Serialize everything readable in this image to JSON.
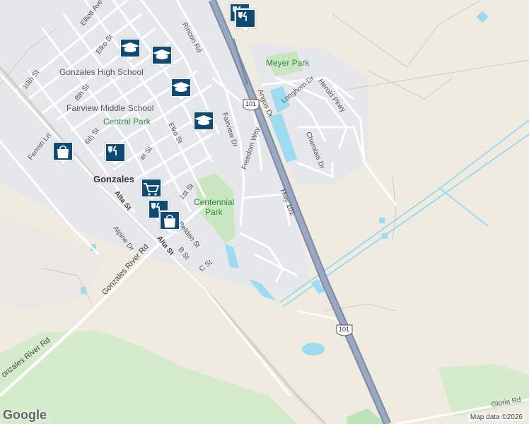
{
  "map": {
    "attribution": "Map data ©2026",
    "logo": "Google",
    "colors": {
      "land": "#efebe1",
      "urban": "#e6e7ea",
      "park": "#c8e6c0",
      "farmland": "#d8ecd0",
      "water": "#9ddcf0",
      "highway": "#8d9db5",
      "road": "#ffffff",
      "marker": "#0f4a74",
      "park_text": "#2e8b45"
    },
    "places": {
      "city": "Gonzales",
      "park_meyer": "Meyer Park",
      "park_central": "Central Park",
      "park_centennial_1": "Centennial",
      "park_centennial_2": "Park",
      "school_high": "Gonzales High School",
      "school_middle": "Fairview Middle School"
    },
    "streets": {
      "elliott": "Elliott Ave",
      "elko1": "Elko St",
      "elko2": "Elko St",
      "tenth": "10th St",
      "eighth": "8th St",
      "sixth": "6th St",
      "rincon": "Rincon Rd",
      "fairview": "Fairview Dr",
      "freedom": "Freedom Way",
      "angus": "Angus Dr",
      "longhorn": "Longhorn Dr",
      "herold": "Herold Pkwy",
      "charolais": "Charolais Dr",
      "fermin": "Fermin Ln",
      "alta1": "Alta St",
      "alta2": "Alta St",
      "first": "1st St",
      "belden": "Belden St",
      "bst": "B St",
      "cst": "C St",
      "alpine": "Alpine Dr",
      "gonzales_river1": "Gonzales River Rd",
      "gonzales_river2": "onzales River Rd",
      "gloria": "Gloria Rd",
      "er": "er St",
      "hwy101_name": "Hwy 101",
      "shield_top": "101",
      "shield_bottom": "101"
    },
    "markers": [
      {
        "icon": "restaurant-icon"
      },
      {
        "icon": "restaurant-icon"
      },
      {
        "icon": "school-icon"
      },
      {
        "icon": "school-icon"
      },
      {
        "icon": "school-icon"
      },
      {
        "icon": "school-icon"
      },
      {
        "icon": "shopping-bag-icon"
      },
      {
        "icon": "restaurant-icon"
      },
      {
        "icon": "shopping-cart-icon"
      },
      {
        "icon": "restaurant-icon"
      },
      {
        "icon": "shopping-bag-icon"
      }
    ]
  }
}
